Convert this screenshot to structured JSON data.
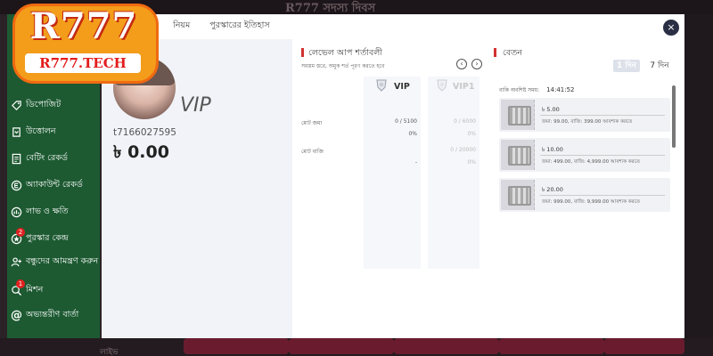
{
  "background": {
    "banner_text": "R777 সদস্য দিবস",
    "bottom_label": "লাইভ"
  },
  "logo": {
    "title": "R777",
    "subtitle": "R777.TECH"
  },
  "sidebar": {
    "items": [
      {
        "label": "ডিপোজিট",
        "icon": "tag-icon"
      },
      {
        "label": "উত্তোলন",
        "icon": "wallet-icon"
      },
      {
        "label": "বেটিং রেকর্ড",
        "icon": "document-icon"
      },
      {
        "label": "অ্যাকাউন্ট রেকর্ড",
        "icon": "coin-icon"
      },
      {
        "label": "লাভ ও ক্ষতি",
        "icon": "chart-icon"
      },
      {
        "label": "পুরস্কার কেন্দ্র",
        "icon": "gift-icon",
        "badge": "2"
      },
      {
        "label": "বন্ধুদের আমন্ত্রণ করুন",
        "icon": "invite-icon"
      },
      {
        "label": "মিশন",
        "icon": "mission-icon",
        "badge": "1"
      },
      {
        "label": "অভ্যন্তরীণ বার্তা",
        "icon": "at-icon"
      }
    ]
  },
  "modal": {
    "tabs": [
      "নিয়ম",
      "পুরস্কারের ইতিহাস"
    ],
    "close_label": "×"
  },
  "profile": {
    "vip_label": "VIP",
    "user_id": "t7166027595",
    "balance": "৳ 0.00"
  },
  "levelup": {
    "title": "লেভেল আপ শর্তাবলী",
    "subtitle": "সমস্তম স্তরে, অমুক শর্ত পূরণ করতে হবে",
    "prev": "‹",
    "next": "›",
    "levels": [
      "VIP",
      "VIP1"
    ],
    "rows": [
      {
        "label": "মোট জমা",
        "current": "0 / 5100",
        "pct": "0%",
        "next": "0 / 6000"
      },
      {
        "label": "মোট বাজি",
        "current": "-",
        "pct": "",
        "next": "0 / 20000",
        "next_pct": "0%"
      }
    ],
    "row0_next_pct": "0%"
  },
  "salary": {
    "title": "বেতন",
    "day_active": "1 দিন",
    "day_inactive": "7 দিন",
    "claim_label": "বাকি অবশিষ্ট সময়:",
    "claim_time": "14:41:52",
    "tickets": [
      {
        "amount": "৳ 5.00",
        "desc": "জমা: 99.00, বাজি: 399.00 আবশ্যক করতে"
      },
      {
        "amount": "৳ 10.00",
        "desc": "জমা: 499.00, বাজি: 4,999.00 আবশ্যক করতে"
      },
      {
        "amount": "৳ 20.00",
        "desc": "জমা: 999.00, বাজি: 9,999.00 আবশ্যক করতে"
      }
    ]
  },
  "colors": {
    "sidebar": "#1d5a32",
    "accent_red": "#d23232",
    "logo_orange": "#f39d1b"
  }
}
